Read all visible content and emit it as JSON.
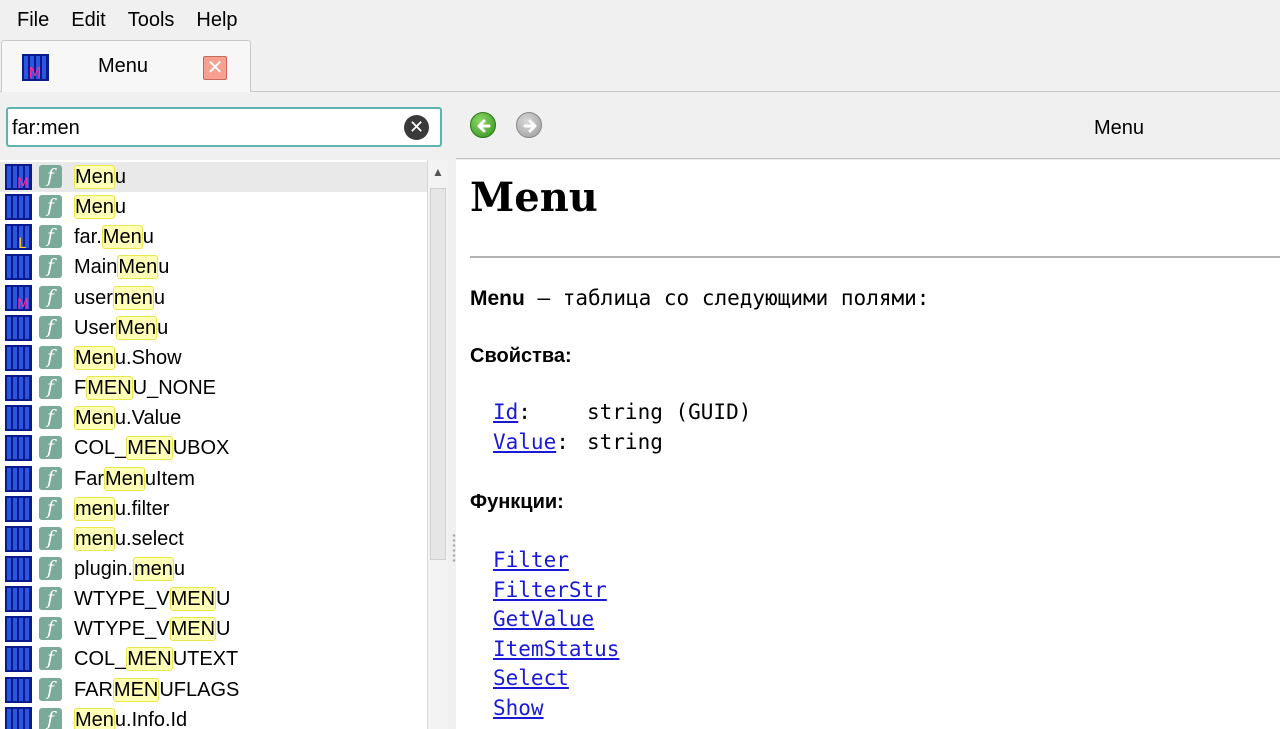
{
  "menubar": {
    "items": [
      {
        "label": "File"
      },
      {
        "label": "Edit"
      },
      {
        "label": "Tools"
      },
      {
        "label": "Help"
      }
    ]
  },
  "tab": {
    "label": "Menu",
    "close_glyph": "✕"
  },
  "search": {
    "value": "far:men",
    "clear_glyph": "✕"
  },
  "results": [
    {
      "icon": "book-m-icon",
      "pre": "",
      "hl": "Men",
      "post": "u"
    },
    {
      "icon": "book-icon",
      "pre": "",
      "hl": "Men",
      "post": "u"
    },
    {
      "icon": "book-l-icon",
      "pre": "far.",
      "hl": "Men",
      "post": "u"
    },
    {
      "icon": "book-icon",
      "pre": "Main",
      "hl": "Men",
      "post": "u"
    },
    {
      "icon": "book-m-icon",
      "pre": "user",
      "hl": "men",
      "post": "u"
    },
    {
      "icon": "book-icon",
      "pre": "User",
      "hl": "Men",
      "post": "u"
    },
    {
      "icon": "book-icon",
      "pre": "",
      "hl": "Men",
      "post": "u.Show"
    },
    {
      "icon": "book-icon",
      "pre": "F",
      "hl": "MEN",
      "post": "U_NONE"
    },
    {
      "icon": "book-icon",
      "pre": "",
      "hl": "Men",
      "post": "u.Value"
    },
    {
      "icon": "book-icon",
      "pre": "COL_",
      "hl": "MEN",
      "post": "UBOX"
    },
    {
      "icon": "book-icon",
      "pre": "Far",
      "hl": "Men",
      "post": "uItem"
    },
    {
      "icon": "book-icon",
      "pre": "",
      "hl": "men",
      "post": "u.filter"
    },
    {
      "icon": "book-icon",
      "pre": "",
      "hl": "men",
      "post": "u.select"
    },
    {
      "icon": "book-icon",
      "pre": "plugin.",
      "hl": "men",
      "post": "u"
    },
    {
      "icon": "book-icon",
      "pre": "WTYPE_V",
      "hl": "MEN",
      "post": "U"
    },
    {
      "icon": "book-icon",
      "pre": "WTYPE_V",
      "hl": "MEN",
      "post": "U"
    },
    {
      "icon": "book-icon",
      "pre": "COL_",
      "hl": "MEN",
      "post": "UTEXT"
    },
    {
      "icon": "book-icon",
      "pre": "FAR",
      "hl": "MEN",
      "post": "UFLAGS"
    },
    {
      "icon": "book-icon",
      "pre": "",
      "hl": "Men",
      "post": "u.Info.Id"
    }
  ],
  "viewer": {
    "toolbar_title": "Menu",
    "heading": "Menu",
    "intro_bold": "Menu",
    "intro_rest": " – таблица со следующими полями:",
    "props_heading": "Свойства:",
    "props": [
      {
        "name": "Id",
        "colon": ":",
        "type": "string (GUID)"
      },
      {
        "name": "Value",
        "colon": ":",
        "type": "string"
      }
    ],
    "funcs_heading": "Функции:",
    "funcs": [
      "Filter",
      "FilterStr",
      "GetValue",
      "ItemStatus",
      "Select",
      "Show"
    ]
  },
  "colors": {
    "highlight_fill": "#ffffb8",
    "highlight_border": "#e8e84a",
    "link": "#1a1ad6",
    "search_border": "#5fb4b1",
    "func_icon": "#7aaa9a"
  }
}
